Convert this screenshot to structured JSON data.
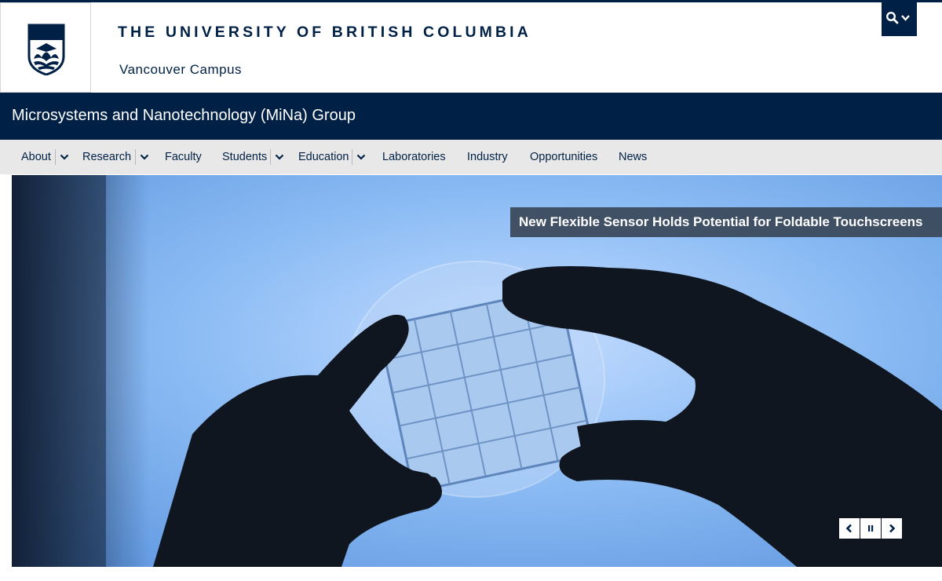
{
  "header": {
    "university_name": "THE UNIVERSITY OF BRITISH COLUMBIA",
    "campus": "Vancouver Campus",
    "logo_text": "UBC",
    "search_icons": [
      "search-icon",
      "chevron-down-icon"
    ]
  },
  "unit": {
    "title": "Microsystems and Nanotechnology (MiNa) Group"
  },
  "nav": {
    "items": [
      {
        "label": "About",
        "has_dropdown": true
      },
      {
        "label": "Research",
        "has_dropdown": true
      },
      {
        "label": "Faculty",
        "has_dropdown": false
      },
      {
        "label": "Students",
        "has_dropdown": true
      },
      {
        "label": "Education",
        "has_dropdown": true
      },
      {
        "label": "Laboratories",
        "has_dropdown": false
      },
      {
        "label": "Industry",
        "has_dropdown": false
      },
      {
        "label": "Opportunities",
        "has_dropdown": false
      },
      {
        "label": "News",
        "has_dropdown": false
      }
    ]
  },
  "slider": {
    "caption": "New Flexible Sensor Holds Potential for Foldable Touchscreens",
    "controls": [
      "chevron-left-icon",
      "pause-icon",
      "chevron-right-icon"
    ]
  },
  "colors": {
    "brand_navy": "#002145",
    "nav_background": "#e8e8e8",
    "caption_background": "#3a4658"
  }
}
